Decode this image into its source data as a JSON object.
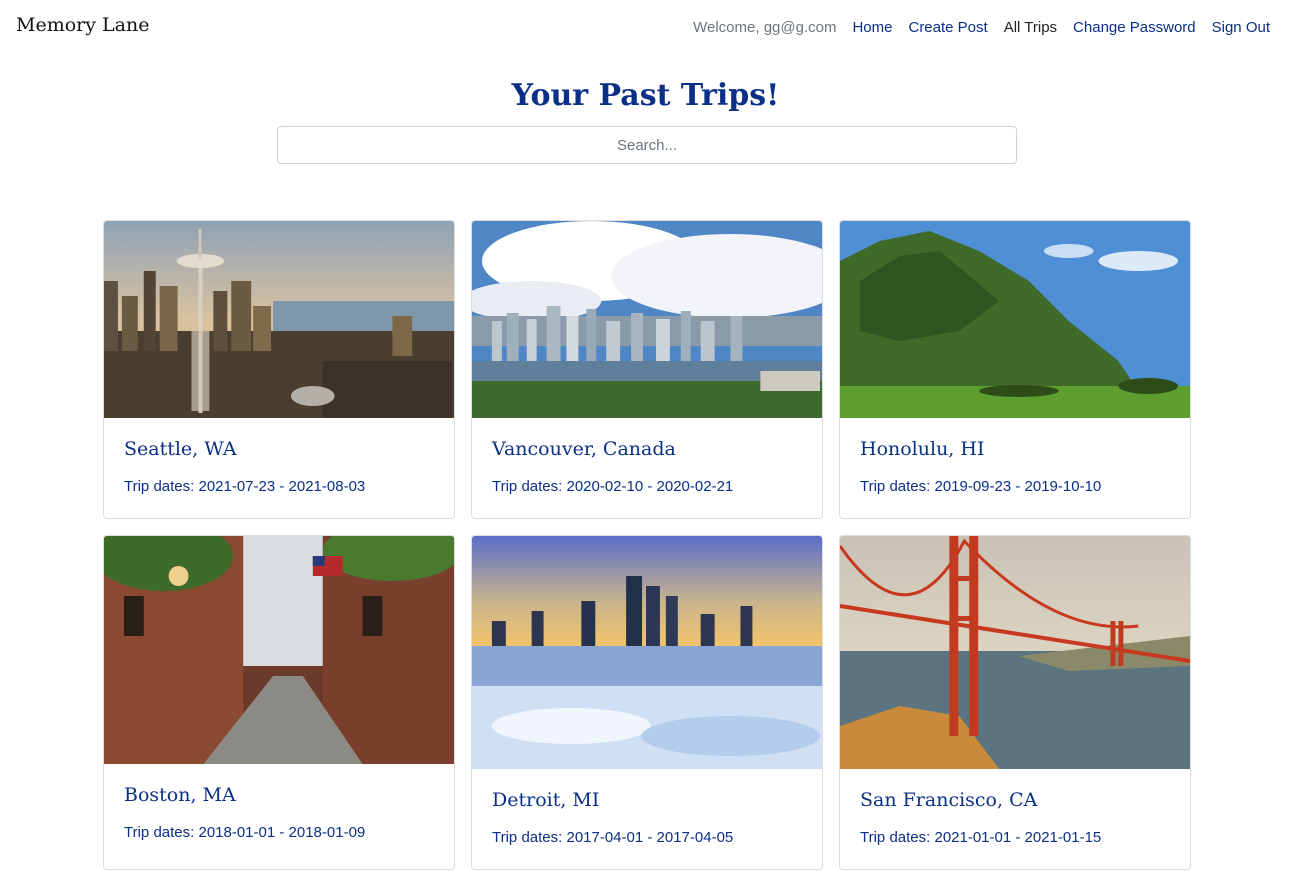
{
  "app": {
    "title": "Memory Lane"
  },
  "nav": {
    "welcome": "Welcome, gg@g.com",
    "home": "Home",
    "create_post": "Create Post",
    "all_trips": "All Trips",
    "change_password": "Change Password",
    "sign_out": "Sign Out"
  },
  "page": {
    "title": "Your Past Trips!",
    "search_placeholder": "Search..."
  },
  "colors": {
    "accent": "#0a2f86",
    "muted": "#6c757d",
    "border": "#dcdcdc"
  },
  "trips": [
    {
      "title": "Seattle, WA",
      "dates": "Trip dates: 2021-07-23 - 2021-08-03",
      "image": "seattle-skyline-photo"
    },
    {
      "title": "Vancouver, Canada",
      "dates": "Trip dates: 2020-02-10 - 2020-02-21",
      "image": "vancouver-skyline-photo"
    },
    {
      "title": "Honolulu, HI",
      "dates": "Trip dates: 2019-09-23 - 2019-10-10",
      "image": "honolulu-mountain-photo"
    },
    {
      "title": "Boston, MA",
      "dates": "Trip dates: 2018-01-01 - 2018-01-09",
      "image": "boston-street-photo"
    },
    {
      "title": "Detroit, MI",
      "dates": "Trip dates: 2017-04-01 - 2017-04-05",
      "image": "detroit-skyline-photo"
    },
    {
      "title": "San Francisco, CA",
      "dates": "Trip dates: 2021-01-01 - 2021-01-15",
      "image": "golden-gate-bridge-photo"
    }
  ]
}
